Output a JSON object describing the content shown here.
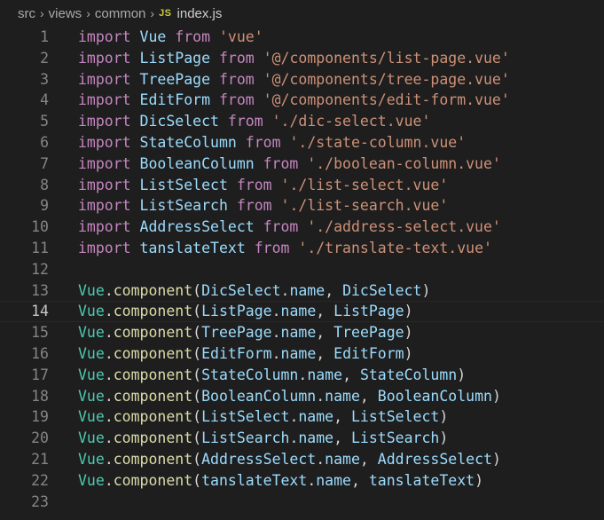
{
  "breadcrumb": {
    "parts": [
      "src",
      "views",
      "common"
    ],
    "file_icon": "JS",
    "file": "index.js"
  },
  "colors": {
    "background": "#1e1e1e",
    "keyword": "#c586c0",
    "identifier": "#9cdcfe",
    "string": "#ce9178",
    "class": "#4ec9b0",
    "function": "#dcdcaa",
    "line_number": "#858585"
  },
  "editor": {
    "active_line": 14,
    "lines": [
      {
        "n": "1",
        "tokens": [
          {
            "t": "kw",
            "v": "import"
          },
          {
            "t": "plain",
            "v": " "
          },
          {
            "t": "id",
            "v": "Vue"
          },
          {
            "t": "plain",
            "v": " "
          },
          {
            "t": "kw",
            "v": "from"
          },
          {
            "t": "plain",
            "v": " "
          },
          {
            "t": "str",
            "v": "'vue'"
          }
        ]
      },
      {
        "n": "2",
        "tokens": [
          {
            "t": "kw",
            "v": "import"
          },
          {
            "t": "plain",
            "v": " "
          },
          {
            "t": "id",
            "v": "ListPage"
          },
          {
            "t": "plain",
            "v": " "
          },
          {
            "t": "kw",
            "v": "from"
          },
          {
            "t": "plain",
            "v": " "
          },
          {
            "t": "str",
            "v": "'@/components/list-page.vue'"
          }
        ]
      },
      {
        "n": "3",
        "tokens": [
          {
            "t": "kw",
            "v": "import"
          },
          {
            "t": "plain",
            "v": " "
          },
          {
            "t": "id",
            "v": "TreePage"
          },
          {
            "t": "plain",
            "v": " "
          },
          {
            "t": "kw",
            "v": "from"
          },
          {
            "t": "plain",
            "v": " "
          },
          {
            "t": "str",
            "v": "'@/components/tree-page.vue'"
          }
        ]
      },
      {
        "n": "4",
        "tokens": [
          {
            "t": "kw",
            "v": "import"
          },
          {
            "t": "plain",
            "v": " "
          },
          {
            "t": "id",
            "v": "EditForm"
          },
          {
            "t": "plain",
            "v": " "
          },
          {
            "t": "kw",
            "v": "from"
          },
          {
            "t": "plain",
            "v": " "
          },
          {
            "t": "str",
            "v": "'@/components/edit-form.vue'"
          }
        ]
      },
      {
        "n": "5",
        "tokens": [
          {
            "t": "kw",
            "v": "import"
          },
          {
            "t": "plain",
            "v": " "
          },
          {
            "t": "id",
            "v": "DicSelect"
          },
          {
            "t": "plain",
            "v": " "
          },
          {
            "t": "kw",
            "v": "from"
          },
          {
            "t": "plain",
            "v": " "
          },
          {
            "t": "str",
            "v": "'./dic-select.vue'"
          }
        ]
      },
      {
        "n": "6",
        "tokens": [
          {
            "t": "kw",
            "v": "import"
          },
          {
            "t": "plain",
            "v": " "
          },
          {
            "t": "id",
            "v": "StateColumn"
          },
          {
            "t": "plain",
            "v": " "
          },
          {
            "t": "kw",
            "v": "from"
          },
          {
            "t": "plain",
            "v": " "
          },
          {
            "t": "str",
            "v": "'./state-column.vue'"
          }
        ]
      },
      {
        "n": "7",
        "tokens": [
          {
            "t": "kw",
            "v": "import"
          },
          {
            "t": "plain",
            "v": " "
          },
          {
            "t": "id",
            "v": "BooleanColumn"
          },
          {
            "t": "plain",
            "v": " "
          },
          {
            "t": "kw",
            "v": "from"
          },
          {
            "t": "plain",
            "v": " "
          },
          {
            "t": "str",
            "v": "'./boolean-column.vue'"
          }
        ]
      },
      {
        "n": "8",
        "tokens": [
          {
            "t": "kw",
            "v": "import"
          },
          {
            "t": "plain",
            "v": " "
          },
          {
            "t": "id",
            "v": "ListSelect"
          },
          {
            "t": "plain",
            "v": " "
          },
          {
            "t": "kw",
            "v": "from"
          },
          {
            "t": "plain",
            "v": " "
          },
          {
            "t": "str",
            "v": "'./list-select.vue'"
          }
        ]
      },
      {
        "n": "9",
        "tokens": [
          {
            "t": "kw",
            "v": "import"
          },
          {
            "t": "plain",
            "v": " "
          },
          {
            "t": "id",
            "v": "ListSearch"
          },
          {
            "t": "plain",
            "v": " "
          },
          {
            "t": "kw",
            "v": "from"
          },
          {
            "t": "plain",
            "v": " "
          },
          {
            "t": "str",
            "v": "'./list-search.vue'"
          }
        ]
      },
      {
        "n": "10",
        "tokens": [
          {
            "t": "kw",
            "v": "import"
          },
          {
            "t": "plain",
            "v": " "
          },
          {
            "t": "id",
            "v": "AddressSelect"
          },
          {
            "t": "plain",
            "v": " "
          },
          {
            "t": "kw",
            "v": "from"
          },
          {
            "t": "plain",
            "v": " "
          },
          {
            "t": "str",
            "v": "'./address-select.vue'"
          }
        ]
      },
      {
        "n": "11",
        "tokens": [
          {
            "t": "kw",
            "v": "import"
          },
          {
            "t": "plain",
            "v": " "
          },
          {
            "t": "id",
            "v": "tanslateText"
          },
          {
            "t": "plain",
            "v": " "
          },
          {
            "t": "kw",
            "v": "from"
          },
          {
            "t": "plain",
            "v": " "
          },
          {
            "t": "str",
            "v": "'./translate-text.vue'"
          }
        ]
      },
      {
        "n": "12",
        "tokens": []
      },
      {
        "n": "13",
        "tokens": [
          {
            "t": "cls",
            "v": "Vue"
          },
          {
            "t": "plain",
            "v": "."
          },
          {
            "t": "fn",
            "v": "component"
          },
          {
            "t": "plain",
            "v": "("
          },
          {
            "t": "id",
            "v": "DicSelect"
          },
          {
            "t": "plain",
            "v": "."
          },
          {
            "t": "id",
            "v": "name"
          },
          {
            "t": "plain",
            "v": ", "
          },
          {
            "t": "id",
            "v": "DicSelect"
          },
          {
            "t": "plain",
            "v": ")"
          }
        ]
      },
      {
        "n": "14",
        "tokens": [
          {
            "t": "cls",
            "v": "Vue"
          },
          {
            "t": "plain",
            "v": "."
          },
          {
            "t": "fn",
            "v": "component"
          },
          {
            "t": "plain",
            "v": "("
          },
          {
            "t": "id",
            "v": "ListPage"
          },
          {
            "t": "plain",
            "v": "."
          },
          {
            "t": "id",
            "v": "name"
          },
          {
            "t": "plain",
            "v": ", "
          },
          {
            "t": "id",
            "v": "ListPage"
          },
          {
            "t": "plain",
            "v": ")"
          }
        ]
      },
      {
        "n": "15",
        "tokens": [
          {
            "t": "cls",
            "v": "Vue"
          },
          {
            "t": "plain",
            "v": "."
          },
          {
            "t": "fn",
            "v": "component"
          },
          {
            "t": "plain",
            "v": "("
          },
          {
            "t": "id",
            "v": "TreePage"
          },
          {
            "t": "plain",
            "v": "."
          },
          {
            "t": "id",
            "v": "name"
          },
          {
            "t": "plain",
            "v": ", "
          },
          {
            "t": "id",
            "v": "TreePage"
          },
          {
            "t": "plain",
            "v": ")"
          }
        ]
      },
      {
        "n": "16",
        "tokens": [
          {
            "t": "cls",
            "v": "Vue"
          },
          {
            "t": "plain",
            "v": "."
          },
          {
            "t": "fn",
            "v": "component"
          },
          {
            "t": "plain",
            "v": "("
          },
          {
            "t": "id",
            "v": "EditForm"
          },
          {
            "t": "plain",
            "v": "."
          },
          {
            "t": "id",
            "v": "name"
          },
          {
            "t": "plain",
            "v": ", "
          },
          {
            "t": "id",
            "v": "EditForm"
          },
          {
            "t": "plain",
            "v": ")"
          }
        ]
      },
      {
        "n": "17",
        "tokens": [
          {
            "t": "cls",
            "v": "Vue"
          },
          {
            "t": "plain",
            "v": "."
          },
          {
            "t": "fn",
            "v": "component"
          },
          {
            "t": "plain",
            "v": "("
          },
          {
            "t": "id",
            "v": "StateColumn"
          },
          {
            "t": "plain",
            "v": "."
          },
          {
            "t": "id",
            "v": "name"
          },
          {
            "t": "plain",
            "v": ", "
          },
          {
            "t": "id",
            "v": "StateColumn"
          },
          {
            "t": "plain",
            "v": ")"
          }
        ]
      },
      {
        "n": "18",
        "tokens": [
          {
            "t": "cls",
            "v": "Vue"
          },
          {
            "t": "plain",
            "v": "."
          },
          {
            "t": "fn",
            "v": "component"
          },
          {
            "t": "plain",
            "v": "("
          },
          {
            "t": "id",
            "v": "BooleanColumn"
          },
          {
            "t": "plain",
            "v": "."
          },
          {
            "t": "id",
            "v": "name"
          },
          {
            "t": "plain",
            "v": ", "
          },
          {
            "t": "id",
            "v": "BooleanColumn"
          },
          {
            "t": "plain",
            "v": ")"
          }
        ]
      },
      {
        "n": "19",
        "tokens": [
          {
            "t": "cls",
            "v": "Vue"
          },
          {
            "t": "plain",
            "v": "."
          },
          {
            "t": "fn",
            "v": "component"
          },
          {
            "t": "plain",
            "v": "("
          },
          {
            "t": "id",
            "v": "ListSelect"
          },
          {
            "t": "plain",
            "v": "."
          },
          {
            "t": "id",
            "v": "name"
          },
          {
            "t": "plain",
            "v": ", "
          },
          {
            "t": "id",
            "v": "ListSelect"
          },
          {
            "t": "plain",
            "v": ")"
          }
        ]
      },
      {
        "n": "20",
        "tokens": [
          {
            "t": "cls",
            "v": "Vue"
          },
          {
            "t": "plain",
            "v": "."
          },
          {
            "t": "fn",
            "v": "component"
          },
          {
            "t": "plain",
            "v": "("
          },
          {
            "t": "id",
            "v": "ListSearch"
          },
          {
            "t": "plain",
            "v": "."
          },
          {
            "t": "id",
            "v": "name"
          },
          {
            "t": "plain",
            "v": ", "
          },
          {
            "t": "id",
            "v": "ListSearch"
          },
          {
            "t": "plain",
            "v": ")"
          }
        ]
      },
      {
        "n": "21",
        "tokens": [
          {
            "t": "cls",
            "v": "Vue"
          },
          {
            "t": "plain",
            "v": "."
          },
          {
            "t": "fn",
            "v": "component"
          },
          {
            "t": "plain",
            "v": "("
          },
          {
            "t": "id",
            "v": "AddressSelect"
          },
          {
            "t": "plain",
            "v": "."
          },
          {
            "t": "id",
            "v": "name"
          },
          {
            "t": "plain",
            "v": ", "
          },
          {
            "t": "id",
            "v": "AddressSelect"
          },
          {
            "t": "plain",
            "v": ")"
          }
        ]
      },
      {
        "n": "22",
        "tokens": [
          {
            "t": "cls",
            "v": "Vue"
          },
          {
            "t": "plain",
            "v": "."
          },
          {
            "t": "fn",
            "v": "component"
          },
          {
            "t": "plain",
            "v": "("
          },
          {
            "t": "id",
            "v": "tanslateText"
          },
          {
            "t": "plain",
            "v": "."
          },
          {
            "t": "id",
            "v": "name"
          },
          {
            "t": "plain",
            "v": ", "
          },
          {
            "t": "id",
            "v": "tanslateText"
          },
          {
            "t": "plain",
            "v": ")"
          }
        ]
      },
      {
        "n": "23",
        "tokens": []
      }
    ]
  }
}
